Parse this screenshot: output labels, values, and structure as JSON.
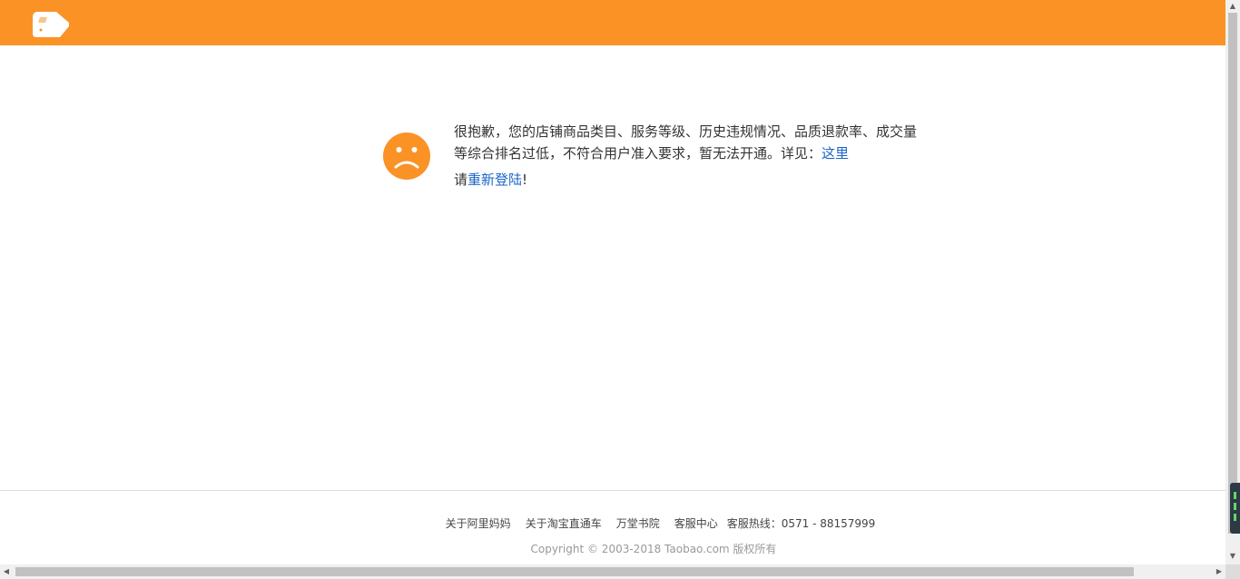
{
  "header": {
    "logo_icon": "taobao-logo-icon",
    "background_color": "#fb9226"
  },
  "message": {
    "icon": "sad-face-icon",
    "icon_color": "#fb9226",
    "line1_text": "很抱歉，您的店铺商品类目、服务等级、历史违规情况、品质退款率、成交量等综合排名过低，不符合用户准入要求，暂无法开通。详见：",
    "line1_link": "这里",
    "line2_prefix": "请",
    "line2_link": "重新登陆",
    "line2_suffix": "!"
  },
  "footer": {
    "links": [
      "关于阿里妈妈",
      "关于淘宝直通车",
      "万堂书院",
      "客服中心"
    ],
    "hotline": "客服热线：0571 - 88157999",
    "copyright": "Copyright © 2003-2018 Taobao.com 版权所有"
  },
  "colors": {
    "link": "#1a66c8",
    "text": "#333333"
  }
}
